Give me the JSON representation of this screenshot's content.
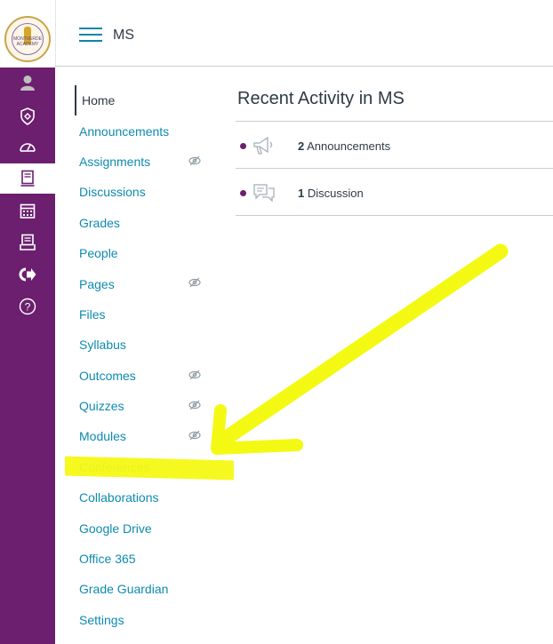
{
  "header": {
    "course_name": "MS",
    "logo_text": "MONTVERDE ACADEMY"
  },
  "global_nav": [
    {
      "icon": "account-icon",
      "active": false
    },
    {
      "icon": "admin-shield-icon",
      "active": false
    },
    {
      "icon": "dashboard-icon",
      "active": false
    },
    {
      "icon": "courses-icon",
      "active": true
    },
    {
      "icon": "calendar-icon",
      "active": false
    },
    {
      "icon": "inbox-icon",
      "active": false
    },
    {
      "icon": "commons-icon",
      "active": false
    },
    {
      "icon": "help-icon",
      "active": false
    }
  ],
  "course_nav": {
    "items": [
      {
        "label": "Home",
        "hidden": false
      },
      {
        "label": "Announcements",
        "hidden": false
      },
      {
        "label": "Assignments",
        "hidden": true
      },
      {
        "label": "Discussions",
        "hidden": false
      },
      {
        "label": "Grades",
        "hidden": false
      },
      {
        "label": "People",
        "hidden": false
      },
      {
        "label": "Pages",
        "hidden": true
      },
      {
        "label": "Files",
        "hidden": false
      },
      {
        "label": "Syllabus",
        "hidden": false
      },
      {
        "label": "Outcomes",
        "hidden": true
      },
      {
        "label": "Quizzes",
        "hidden": true
      },
      {
        "label": "Modules",
        "hidden": true
      },
      {
        "label": "Conferences",
        "hidden": false
      },
      {
        "label": "Collaborations",
        "hidden": false
      },
      {
        "label": "Google Drive",
        "hidden": false
      },
      {
        "label": "Office 365",
        "hidden": false
      },
      {
        "label": "Grade Guardian",
        "hidden": false
      },
      {
        "label": "Settings",
        "hidden": false
      }
    ]
  },
  "main": {
    "title": "Recent Activity in MS",
    "activity": [
      {
        "count": "2",
        "label": "Announcements",
        "icon": "announcement-icon"
      },
      {
        "count": "1",
        "label": "Discussion",
        "icon": "discussion-icon"
      }
    ]
  },
  "colors": {
    "global_nav_bg": "#6b1f6e",
    "link": "#0e8ab1",
    "text": "#2d3b45",
    "annotation": "#f4f914"
  }
}
